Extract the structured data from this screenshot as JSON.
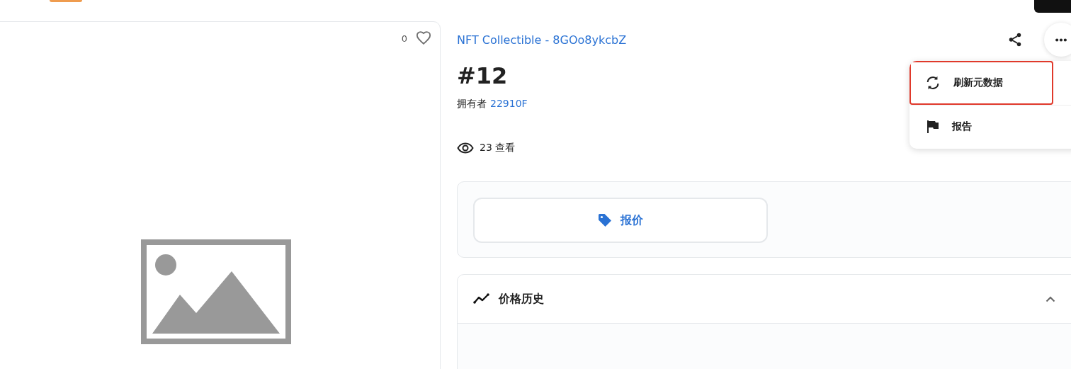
{
  "item": {
    "like_count": "0",
    "collection": "NFT Collectible - 8GOo8ykcbZ",
    "title": "#12",
    "owner_label": "拥有者",
    "owner": "22910F",
    "views": "23 查看"
  },
  "menu": {
    "open": true,
    "items": [
      {
        "kind": "refresh",
        "label": "刷新元数据",
        "highlighted": true
      },
      {
        "kind": "flag",
        "label": "报告",
        "highlighted": false
      }
    ]
  },
  "offer_button": "报价",
  "price_history": {
    "title": "价格历史",
    "expanded": true
  }
}
